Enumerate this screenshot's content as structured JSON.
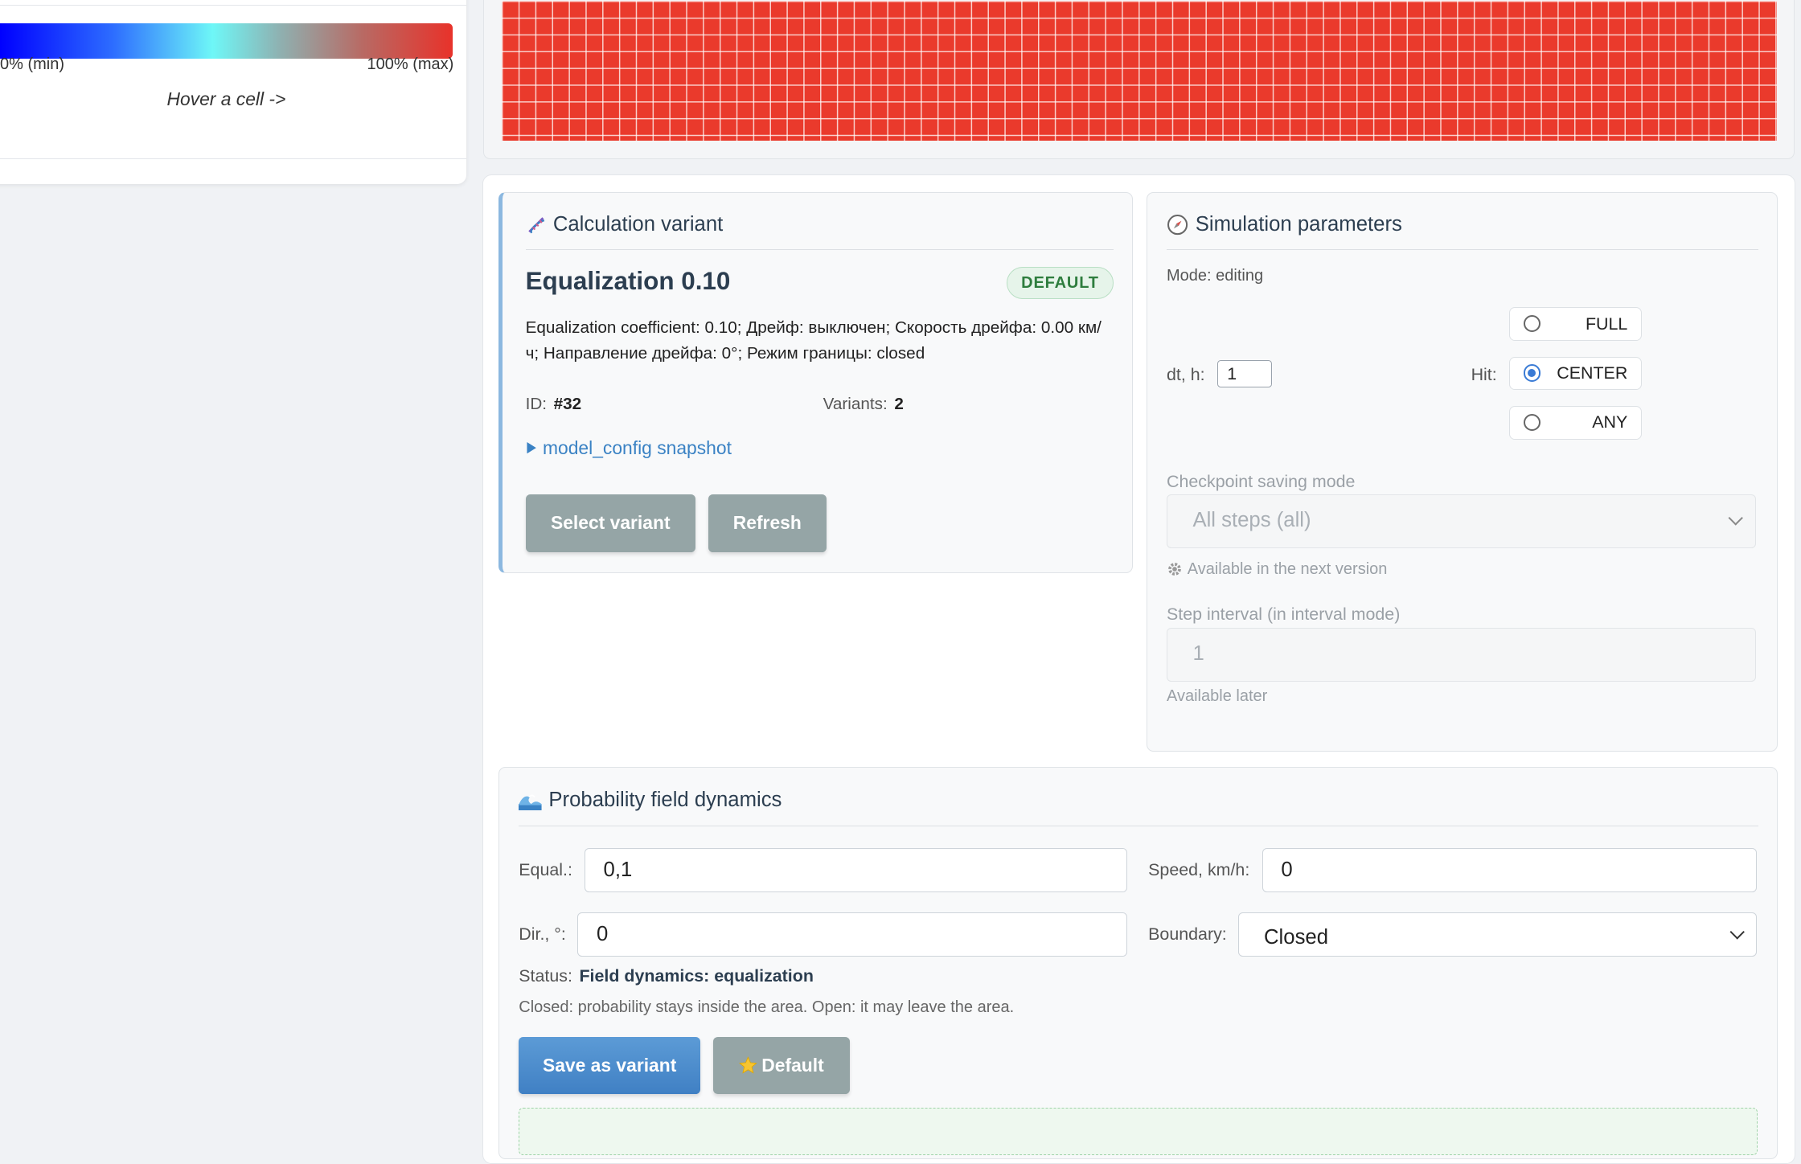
{
  "legend": {
    "min_label": "0% (min)",
    "max_label": "100% (max)",
    "hover_hint": "Hover a cell ->"
  },
  "variant": {
    "title": "Calculation variant",
    "title_icon": "dna-icon",
    "name": "Equalization 0.10",
    "badge": "DEFAULT",
    "description": "Equalization coefficient: 0.10; Дрейф: выключен; Скорость дрейфа: 0.00 км/ч; Направление дрейфа: 0°; Режим границы: closed",
    "id_label": "ID:",
    "id_value": "#32",
    "variants_label": "Variants:",
    "variants_value": "2",
    "snapshot_link": "model_config snapshot",
    "select_button": "Select variant",
    "refresh_button": "Refresh"
  },
  "sim": {
    "title": "Simulation parameters",
    "title_icon": "compass-icon",
    "mode": "Mode: editing",
    "dt_label": "dt, h:",
    "dt_value": "1",
    "hit_label": "Hit:",
    "hit_options": [
      "FULL",
      "CENTER",
      "ANY"
    ],
    "hit_selected": "CENTER",
    "checkpoint_label": "Checkpoint saving mode",
    "checkpoint_value": "All steps (all)",
    "checkpoint_note": "Available in the next version",
    "interval_label": "Step interval (in interval mode)",
    "interval_value": "1",
    "interval_note": "Available later"
  },
  "dynamics": {
    "title": "Probability field dynamics",
    "title_icon": "wave-icon",
    "equal_label": "Equal.:",
    "equal_value": "0,1",
    "speed_label": "Speed, km/h:",
    "speed_value": "0",
    "dir_label": "Dir., °:",
    "dir_value": "0",
    "boundary_label": "Boundary:",
    "boundary_value": "Closed",
    "status_label": "Status:",
    "status_value": "Field dynamics: equalization",
    "hint": "Closed: probability stays inside the area. Open: it may leave the area.",
    "save_button": "Save as variant",
    "default_button": "Default",
    "default_icon": "star-icon"
  },
  "colors": {
    "grid_fill": "#ea3a2c",
    "accent": "#3a7bd5",
    "gradient": [
      "#0000ff",
      "#6ef7f7",
      "#e8322a"
    ]
  }
}
